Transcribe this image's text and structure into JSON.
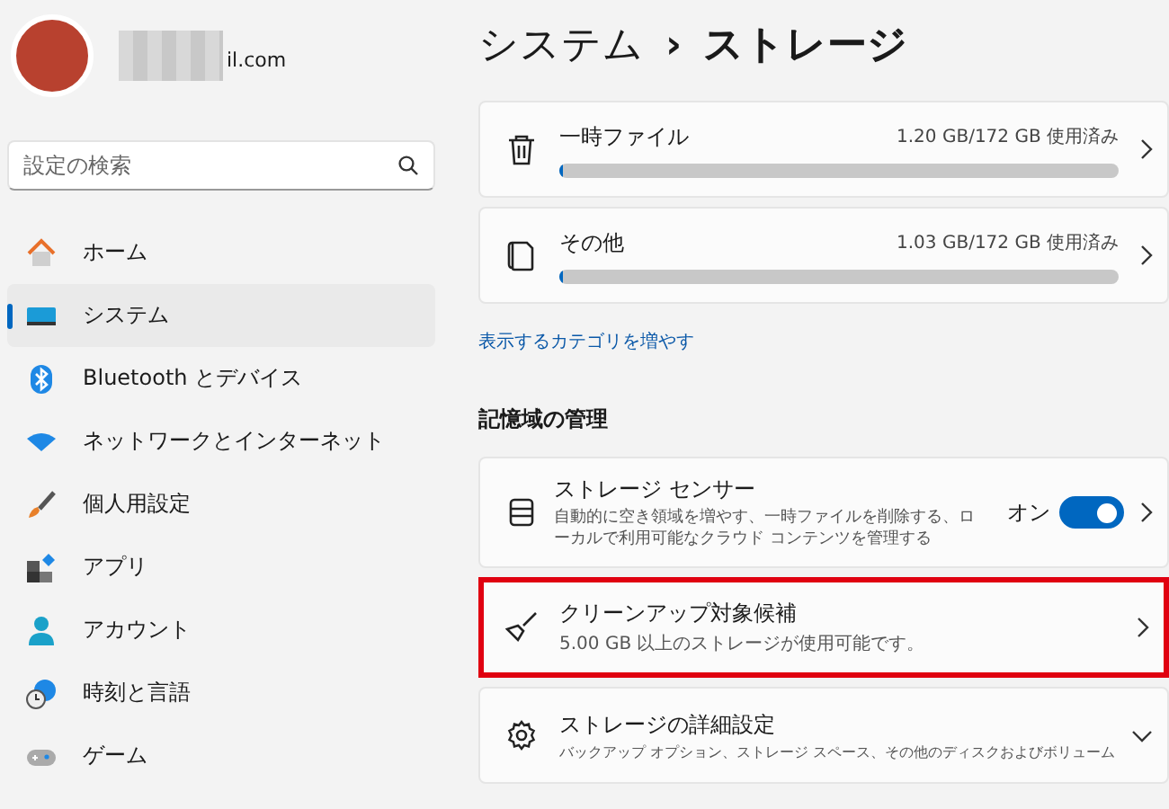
{
  "account": {
    "email_visible": "il.com"
  },
  "search": {
    "placeholder": "設定の検索"
  },
  "nav": [
    {
      "label": "ホーム",
      "selected": false
    },
    {
      "label": "システム",
      "selected": true
    },
    {
      "label": "Bluetooth とデバイス",
      "selected": false
    },
    {
      "label": "ネットワークとインターネット",
      "selected": false
    },
    {
      "label": "個人用設定",
      "selected": false
    },
    {
      "label": "アプリ",
      "selected": false
    },
    {
      "label": "アカウント",
      "selected": false
    },
    {
      "label": "時刻と言語",
      "selected": false
    },
    {
      "label": "ゲーム",
      "selected": false
    }
  ],
  "breadcrumb": {
    "parent": "システム",
    "separator": "›",
    "current": "ストレージ"
  },
  "categories": [
    {
      "kind": "usage",
      "title": "一時ファイル",
      "usage": "1.20 GB/172 GB 使用済み",
      "level": 0.007
    },
    {
      "kind": "usage",
      "title": "その他",
      "usage": "1.03 GB/172 GB 使用済み",
      "level": 0.006
    }
  ],
  "more_link": "表示するカテゴリを増やす",
  "section_title": "記憶域の管理",
  "management": [
    {
      "kind": "toggle",
      "title": "ストレージ センサー",
      "description": "自動的に空き領域を増やす、一時ファイルを削除する、ローカルで利用可能なクラウド コンテンツを管理する",
      "state_label": "オン",
      "on": true,
      "highlighted": false
    },
    {
      "kind": "nav",
      "title": "クリーンアップ対象候補",
      "description": "5.00 GB 以上のストレージが使用可能です。",
      "highlighted": true
    },
    {
      "kind": "expand",
      "title": "ストレージの詳細設定",
      "description": "バックアップ オプション、ストレージ スペース、その他のディスクおよびボリューム",
      "highlighted": false
    }
  ]
}
